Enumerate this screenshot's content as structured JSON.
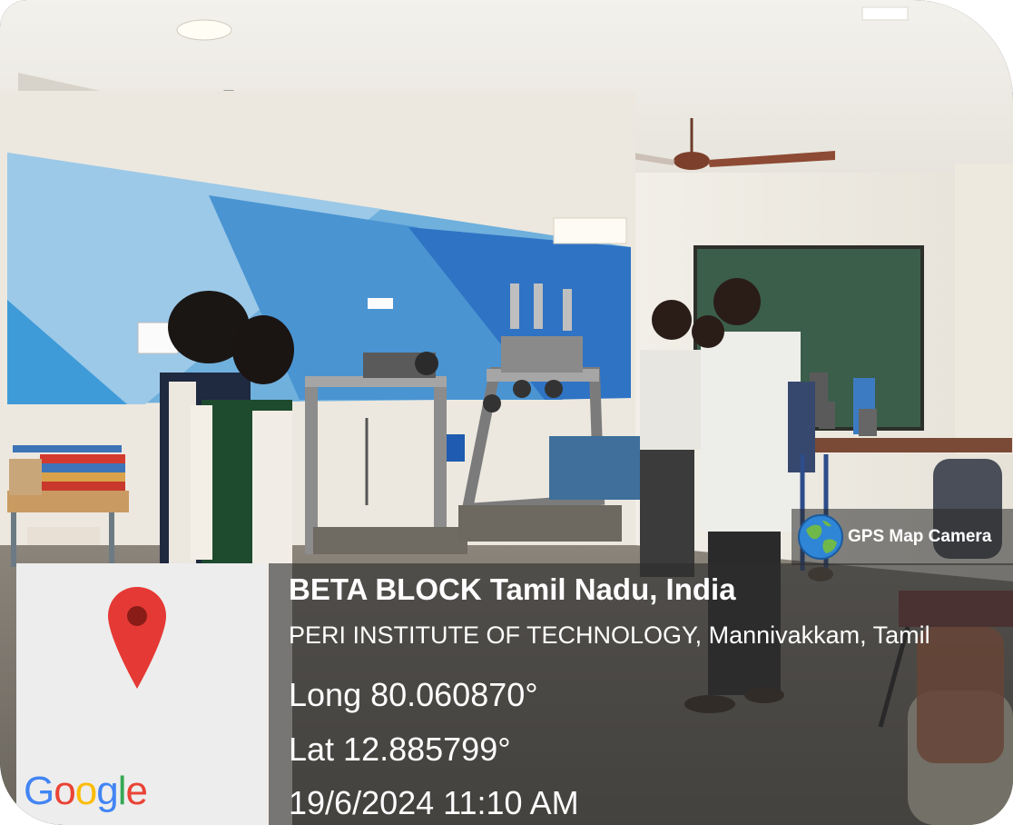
{
  "watermark": {
    "label": "GPS Map Camera",
    "icon": "globe-icon"
  },
  "map": {
    "logo_text": "Google",
    "pin_icon": "map-pin-icon",
    "pin_color": "#e53935"
  },
  "location": {
    "title": "BETA BLOCK Tamil Nadu, India",
    "address": "PERI INSTITUTE OF TECHNOLOGY, Mannivakkam, Tamil",
    "longitude": "Long 80.060870°",
    "latitude": "Lat 12.885799°",
    "timestamp": "19/6/2024 11:10 AM"
  }
}
